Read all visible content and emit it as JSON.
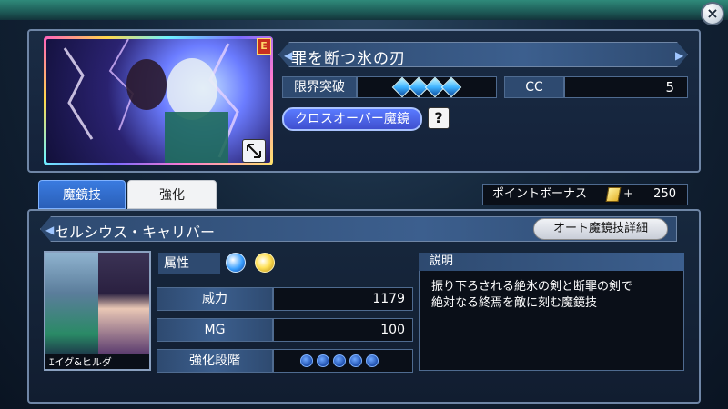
{
  "header": {
    "close_label": "×"
  },
  "card": {
    "rarity": "E",
    "title": "罪を断つ氷の刃"
  },
  "limit_break": {
    "label": "限界突破",
    "gems": 4
  },
  "cc": {
    "label": "CC",
    "value": "5"
  },
  "crossover": {
    "label": "クロスオーバー魔鏡",
    "help": "?"
  },
  "tabs": [
    {
      "label": "魔鏡技",
      "active": true
    },
    {
      "label": "強化",
      "active": false
    }
  ],
  "point_bonus": {
    "label": "ポイントボーナス",
    "plus": "+",
    "value": "250"
  },
  "skill": {
    "name": "セルシウス・キャリバー",
    "auto_detail_button": "オート魔鏡技詳細"
  },
  "characters": {
    "label": "ｴイグ&ヒルダ"
  },
  "attribute": {
    "label": "属性",
    "icons": [
      "water-element-icon",
      "light-element-icon"
    ]
  },
  "stats": [
    {
      "label": "威力",
      "value": "1179"
    },
    {
      "label": "MG",
      "value": "100"
    },
    {
      "label": "強化段階",
      "stages": 5
    }
  ],
  "description": {
    "header": "説明",
    "lines": [
      "振り下ろされる絶氷の剣と断罪の剣で",
      "絶対なる終焉を敵に刻む魔鏡技"
    ]
  },
  "colors": {
    "accent": "#3a7be0",
    "panel": "#14223a",
    "gem": "#3fb3ff"
  }
}
